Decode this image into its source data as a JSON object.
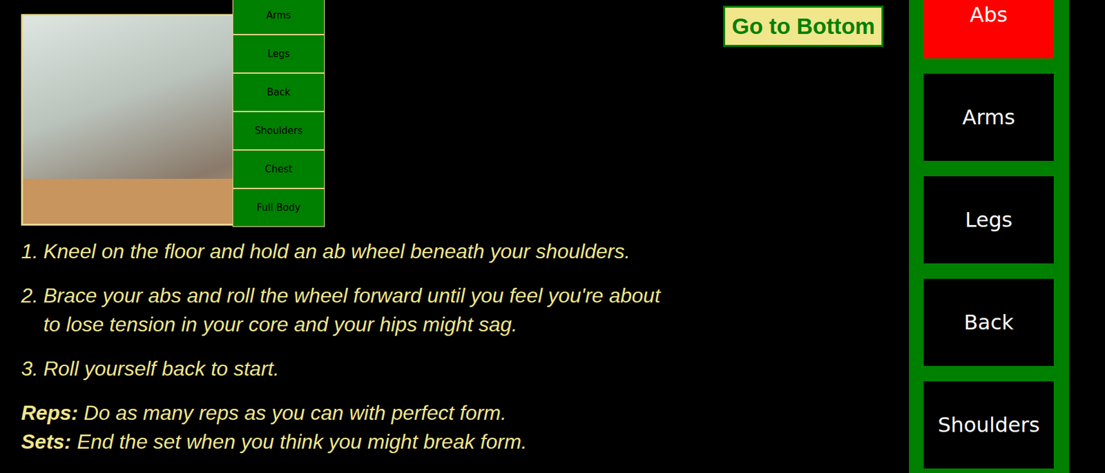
{
  "page": {
    "button": "Go to Bottom"
  },
  "dropdown": {
    "items": [
      "Arms",
      "Legs",
      "Back",
      "Shoulders",
      "Chest",
      "Full Body"
    ]
  },
  "sidebar": {
    "items": [
      {
        "label": "Abs",
        "selected": true
      },
      {
        "label": "Arms",
        "selected": false
      },
      {
        "label": "Legs",
        "selected": false
      },
      {
        "label": "Back",
        "selected": false
      },
      {
        "label": "Shoulders",
        "selected": false
      }
    ]
  },
  "steps": [
    "Kneel on the floor and hold an ab wheel beneath your shoulders.",
    "Brace your abs and roll the wheel forward until you feel you're about to lose tension in your core and your hips might sag.",
    "Roll yourself back to start."
  ],
  "details": [
    {
      "label": "Reps:",
      "text": "Do as many reps as you can with perfect form."
    },
    {
      "label": "Sets:",
      "text": "End the set when you think you might break form."
    }
  ]
}
